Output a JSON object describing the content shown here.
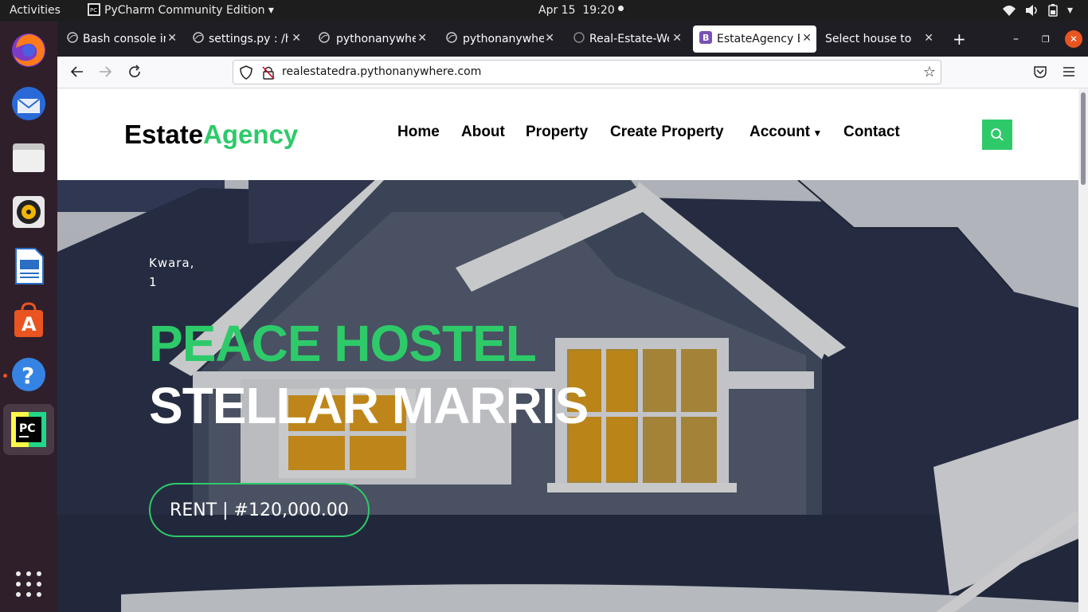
{
  "topbar": {
    "activities": "Activities",
    "app": "PyCharm Community Edition",
    "date": "Apr 15",
    "time": "19:20"
  },
  "dock": {
    "items": [
      "firefox-icon",
      "thunderbird-icon",
      "files-icon",
      "rhythmbox-icon",
      "libreoffice-writer-icon",
      "app-center-icon",
      "help-icon",
      "pycharm-icon",
      "show-apps-icon"
    ]
  },
  "tabs": [
    {
      "label": "Bash console in"
    },
    {
      "label": "settings.py : /ho"
    },
    {
      "label": "pythonanywhere"
    },
    {
      "label": "pythonanywhere"
    },
    {
      "label": "Real-Estate-We"
    },
    {
      "label": "EstateAgency B",
      "favicon": "B"
    },
    {
      "label": "Select house to ch"
    }
  ],
  "address": {
    "url": "realestatedra.pythonanywhere.com"
  },
  "site": {
    "brand_part1": "Estate",
    "brand_part2": "Agency",
    "nav": {
      "home": "Home",
      "about": "About",
      "property": "Property",
      "create": "Create Property",
      "account": "Account",
      "contact": "Contact"
    }
  },
  "hero": {
    "location_line1": "Kwara,",
    "location_line2": "1",
    "title_line1": "PEACE HOSTEL",
    "title_line2": "STELLAR MARRIS",
    "price": "RENT | #120,000.00"
  },
  "colors": {
    "accent": "#2eca6a",
    "dock": "#2f1f2b",
    "roof": "#2e3650"
  }
}
